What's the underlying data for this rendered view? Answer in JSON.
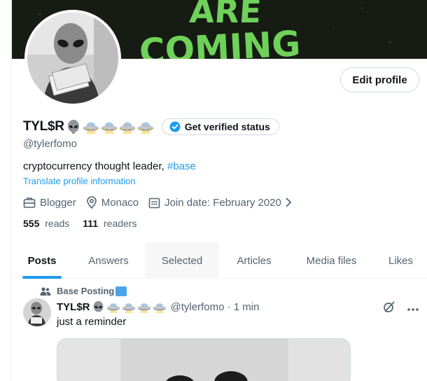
{
  "banner": {
    "text_top": "ARE",
    "text_bottom": "COMING"
  },
  "profile": {
    "edit_label": "Edit profile",
    "display_name": "TYL$R",
    "emoji_icons": [
      "alien-icon",
      "ufo-icon",
      "ufo-icon",
      "ufo-icon",
      "ufo-icon"
    ],
    "verify_label": "Get verified status",
    "handle": "@tylerfomo",
    "bio_text": "cryptocurrency thought leader, ",
    "bio_hashtag": "#base",
    "translate_label": "Translate profile information",
    "meta": {
      "profession": "Blogger",
      "location": "Monaco",
      "join_date": "Join date: February 2020"
    },
    "stats": {
      "reads_count": "555",
      "reads_label": "reads",
      "readers_count": "111",
      "readers_label": "readers"
    }
  },
  "tabs": [
    {
      "label": "Posts",
      "active": true
    },
    {
      "label": "Answers",
      "active": false
    },
    {
      "label": "Selected",
      "active": false
    },
    {
      "label": "Articles",
      "active": false
    },
    {
      "label": "Media files",
      "active": false
    },
    {
      "label": "Likes",
      "active": false
    }
  ],
  "post": {
    "community": "Base Posting",
    "author_name": "TYL$R",
    "author_handle": "@tylerfomo",
    "time_sep": " · ",
    "time": "1 min",
    "text": "just a reminder"
  },
  "colors": {
    "accent": "#1d9bf0",
    "text_primary": "#0f1419",
    "text_secondary": "#536471",
    "banner_green": "#6fd15a"
  }
}
